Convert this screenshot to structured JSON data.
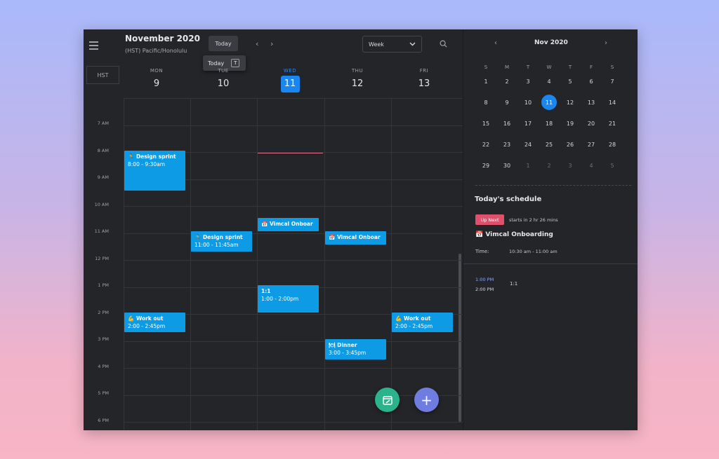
{
  "header": {
    "month_title": "November 2020",
    "timezone": "(HST) Pacific/Honolulu",
    "today_button": "Today",
    "tooltip_label": "Today",
    "tooltip_key": "T",
    "view_select": "Week",
    "tz_abbrev": "HST"
  },
  "days": [
    {
      "name": "MON",
      "num": "9"
    },
    {
      "name": "TUE",
      "num": "10"
    },
    {
      "name": "WED",
      "num": "11"
    },
    {
      "name": "THU",
      "num": "12"
    },
    {
      "name": "FRI",
      "num": "13"
    }
  ],
  "time_labels": [
    "7 AM",
    "8 AM",
    "9 AM",
    "10 AM",
    "11 AM",
    "12 PM",
    "1 PM",
    "2 PM",
    "3 PM",
    "4 PM",
    "5 PM",
    "6 PM"
  ],
  "events": [
    {
      "day": 0,
      "start": 8.0,
      "end": 9.5,
      "title": "🏃 Design sprint",
      "time": "8:00 - 9:30am"
    },
    {
      "day": 1,
      "start": 11.0,
      "end": 11.75,
      "title": "🏃 Design sprint",
      "time": "11:00 - 11:45am"
    },
    {
      "day": 2,
      "start": 10.5,
      "end": 11.0,
      "title": "📅 Vimcal Onboar",
      "time": ""
    },
    {
      "day": 3,
      "start": 11.0,
      "end": 11.5,
      "title": "📅 Vimcal Onboar",
      "time": ""
    },
    {
      "day": 2,
      "start": 13.0,
      "end": 14.0,
      "title": "1:1",
      "time": "1:00 - 2:00pm"
    },
    {
      "day": 0,
      "start": 14.0,
      "end": 14.75,
      "title": "💪 Work out",
      "time": "2:00 - 2:45pm"
    },
    {
      "day": 4,
      "start": 14.0,
      "end": 14.75,
      "title": "💪 Work out",
      "time": "2:00 - 2:45pm"
    },
    {
      "day": 3,
      "start": 15.0,
      "end": 15.75,
      "title": "🍽 Dinner",
      "time": "3:00 - 3:45pm"
    }
  ],
  "mini_calendar": {
    "title": "Nov 2020",
    "dow": [
      "S",
      "M",
      "T",
      "W",
      "T",
      "F",
      "S"
    ],
    "weeks": [
      [
        "1",
        "2",
        "3",
        "4",
        "5",
        "6",
        "7"
      ],
      [
        "8",
        "9",
        "10",
        "11",
        "12",
        "13",
        "14"
      ],
      [
        "15",
        "16",
        "17",
        "18",
        "19",
        "20",
        "21"
      ],
      [
        "22",
        "23",
        "24",
        "25",
        "26",
        "27",
        "28"
      ],
      [
        "29",
        "30",
        "1",
        "2",
        "3",
        "4",
        "5"
      ]
    ],
    "today": "11"
  },
  "schedule": {
    "title": "Today's schedule",
    "badge": "Up Next",
    "starts_in": "starts in 2 hr 26 mins",
    "event_title": "📅 Vimcal Onboarding",
    "time_label": "Time:",
    "time_value": "10:30 am - 11:00 am",
    "agenda_start": "1:00 PM",
    "agenda_end": "2:00 PM",
    "agenda_title": "1:1"
  },
  "colors": {
    "accent": "#1a86f0",
    "event": "#0d9be6",
    "up_next": "#e0506b",
    "fab_green": "#2bb38b",
    "fab_purple": "#6f7de0"
  }
}
